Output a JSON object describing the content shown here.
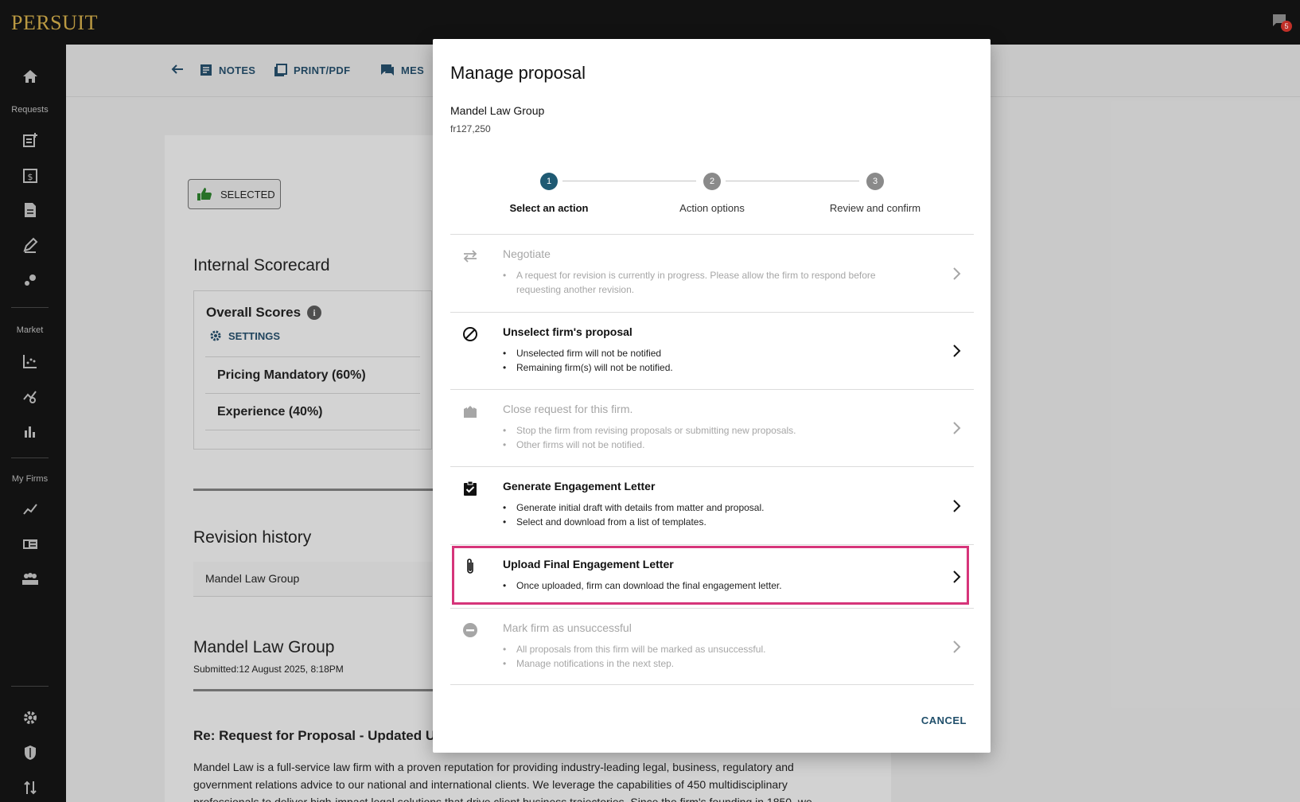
{
  "app": {
    "logo": "PERSUIT",
    "notification_count": "5"
  },
  "sidebar": {
    "sections": [
      {
        "label": "Requests"
      },
      {
        "label": "Market"
      },
      {
        "label": "My Firms"
      }
    ],
    "icons": [
      "home-icon",
      "new-request-icon",
      "calendar-dollar-icon",
      "document-icon",
      "pen-icon",
      "dots-icon",
      "chart-scatter-icon",
      "analytics-search-icon",
      "bar-chart-icon",
      "trend-icon",
      "firm-card-icon",
      "group-icon",
      "gear-icon",
      "shield-icon",
      "transfer-icon"
    ]
  },
  "actionbar": {
    "notes": "NOTES",
    "print": "PRINT/PDF",
    "messages": "MES"
  },
  "background": {
    "selected_chip": "SELECTED",
    "scorecard_title": "Internal Scorecard",
    "overall_scores": "Overall Scores",
    "settings": "SETTINGS",
    "criteria": [
      "Pricing Mandatory (60%)",
      "Experience (40%)"
    ],
    "revision_title": "Revision history",
    "revision_firm": "Mandel Law Group",
    "firm_heading": "Mandel Law Group",
    "submitted": "Submitted:12 August 2025, 8:18PM",
    "re_heading": "Re: Request for Proposal - Updated U",
    "body_line1": "Mandel Law is a full-service law firm with a proven reputation for providing industry-leading legal, business, regulatory and",
    "body_line2": "government relations advice to our national and international clients. We leverage the capabilities of 450 multidisciplinary",
    "body_line3": "professionals to deliver high-impact legal solutions that drive client business trajectories. Since the firm's founding in 1850, we"
  },
  "modal": {
    "title": "Manage proposal",
    "firm": "Mandel Law Group",
    "amount": "fr127,250",
    "steps": [
      {
        "num": "1",
        "label": "Select an action",
        "active": true
      },
      {
        "num": "2",
        "label": "Action options",
        "active": false
      },
      {
        "num": "3",
        "label": "Review and confirm",
        "active": false
      }
    ],
    "options": [
      {
        "title": "Negotiate",
        "icon": "swap-arrows-icon",
        "disabled": true,
        "bullets": [
          "A request for revision is currently in progress. Please allow the firm to respond before requesting another revision."
        ]
      },
      {
        "title": "Unselect firm's proposal",
        "icon": "block-icon",
        "disabled": false,
        "bullets": [
          "Unselected firm will not be notified",
          "Remaining firm(s) will not be notified."
        ]
      },
      {
        "title": "Close request for this firm.",
        "icon": "inbox-icon",
        "disabled": true,
        "bullets": [
          "Stop the firm from revising proposals or submitting new proposals.",
          "Other firms will not be notified."
        ]
      },
      {
        "title": "Generate Engagement Letter",
        "icon": "clipboard-check-icon",
        "disabled": false,
        "bullets": [
          "Generate initial draft with details from matter and proposal.",
          "Select and download from a list of templates."
        ]
      },
      {
        "title": "Upload Final Engagement Letter",
        "icon": "paperclip-icon",
        "disabled": false,
        "highlighted": true,
        "bullets": [
          "Once uploaded, firm can download the final engagement letter."
        ]
      },
      {
        "title": "Mark firm as unsuccessful",
        "icon": "minus-circle-icon",
        "disabled": true,
        "bullets": [
          "All proposals from this firm will be marked as unsuccessful.",
          "Manage notifications in the next step."
        ]
      }
    ],
    "cancel": "CANCEL"
  },
  "colors": {
    "step_active": "#1f5a73",
    "step_inactive": "#8a8a8a",
    "highlight": "#d6357a",
    "link": "#1f4e6a"
  }
}
